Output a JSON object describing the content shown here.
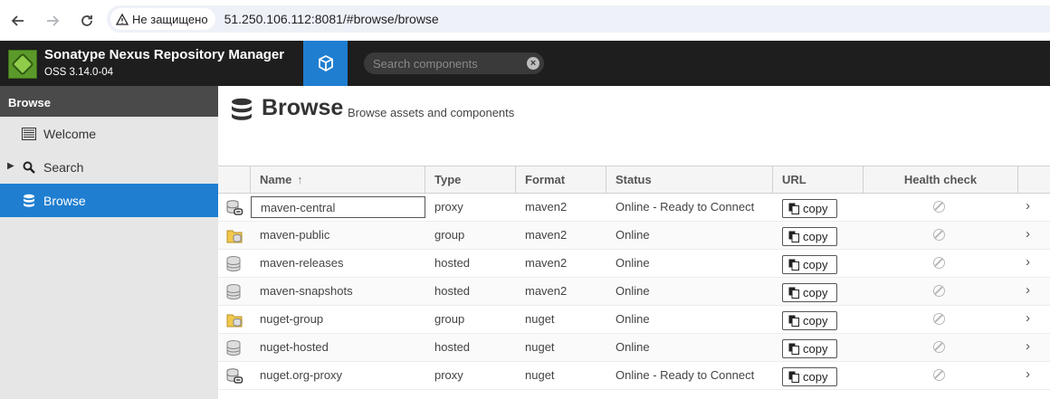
{
  "browser": {
    "security_label": "Не защищено",
    "url": "51.250.106.112:8081/#browse/browse"
  },
  "app": {
    "brand": "Sonatype Nexus Repository Manager",
    "version": "OSS 3.14.0-04",
    "search_placeholder": "Search components"
  },
  "sidebar": {
    "header": "Browse",
    "items": [
      {
        "label": "Welcome",
        "icon": "list-icon"
      },
      {
        "label": "Search",
        "icon": "magnifier-icon"
      },
      {
        "label": "Browse",
        "icon": "database-icon"
      }
    ]
  },
  "page": {
    "title": "Browse",
    "subtitle": "Browse assets and components"
  },
  "table": {
    "columns": [
      "Name",
      "Type",
      "Format",
      "Status",
      "URL",
      "Health check"
    ],
    "sort_indicator": "↑",
    "copy_label": "copy",
    "rows": [
      {
        "name": "maven-central",
        "type": "proxy",
        "format": "maven2",
        "status": "Online - Ready to Connect",
        "icon": "proxy-repo-icon"
      },
      {
        "name": "maven-public",
        "type": "group",
        "format": "maven2",
        "status": "Online",
        "icon": "group-repo-icon"
      },
      {
        "name": "maven-releases",
        "type": "hosted",
        "format": "maven2",
        "status": "Online",
        "icon": "hosted-repo-icon"
      },
      {
        "name": "maven-snapshots",
        "type": "hosted",
        "format": "maven2",
        "status": "Online",
        "icon": "hosted-repo-icon"
      },
      {
        "name": "nuget-group",
        "type": "group",
        "format": "nuget",
        "status": "Online",
        "icon": "group-repo-icon"
      },
      {
        "name": "nuget-hosted",
        "type": "hosted",
        "format": "nuget",
        "status": "Online",
        "icon": "hosted-repo-icon"
      },
      {
        "name": "nuget.org-proxy",
        "type": "proxy",
        "format": "nuget",
        "status": "Online - Ready to Connect",
        "icon": "proxy-repo-icon"
      }
    ]
  },
  "colors": {
    "accent": "#1f7ed0",
    "header_bg": "#1e1e1e",
    "sidebar_bg": "#e6e6e6"
  }
}
